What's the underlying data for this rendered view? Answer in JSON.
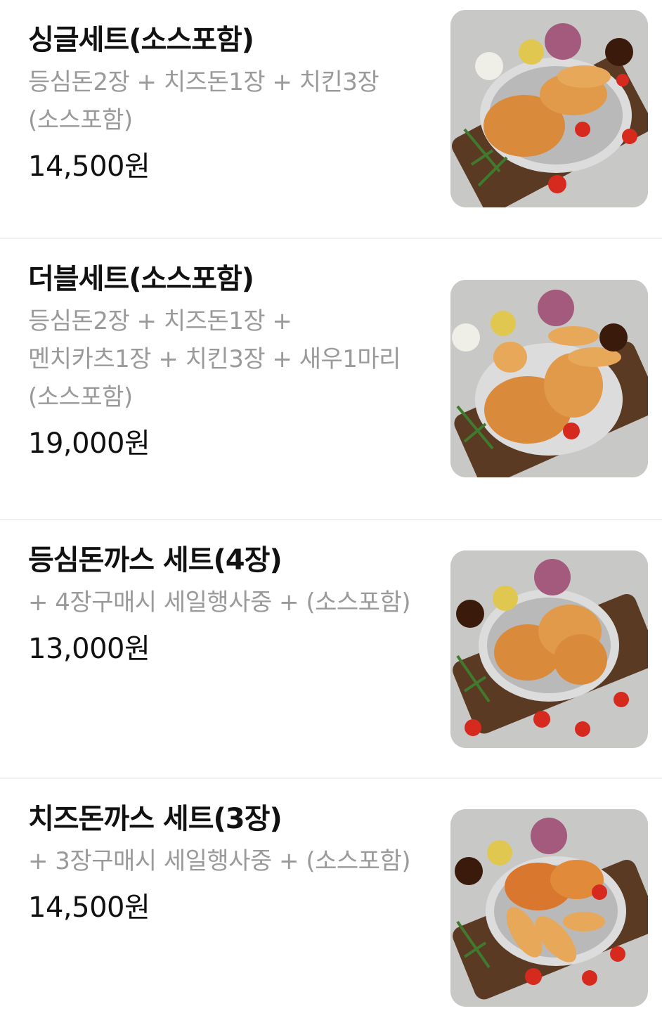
{
  "menu_items": [
    {
      "name": "싱글세트(소스포함)",
      "description": "등심돈2장 + 치즈돈1장 + 치킨3장 (소스포함)",
      "price": "14,500원"
    },
    {
      "name": "더블세트(소스포함)",
      "description": "등심돈2장 + 치즈돈1장 + 멘치카츠1장 + 치킨3장 + 새우1마리 (소스포함)",
      "price": "19,000원"
    },
    {
      "name": "등심돈까스 세트(4장)",
      "description": "+ 4장구매시 세일행사중 + (소스포함)",
      "price": "13,000원"
    },
    {
      "name": "치즈돈까스 세트(3장)",
      "description": "+ 3장구매시 세일행사중 + (소스포함)",
      "price": "14,500원"
    }
  ],
  "colors": {
    "title": "#111111",
    "description": "#9a9a9a",
    "divider": "#f0f0f0",
    "cutlet": "#d98a3a",
    "board": "#5a3a22",
    "tomato": "#d62a1f"
  }
}
